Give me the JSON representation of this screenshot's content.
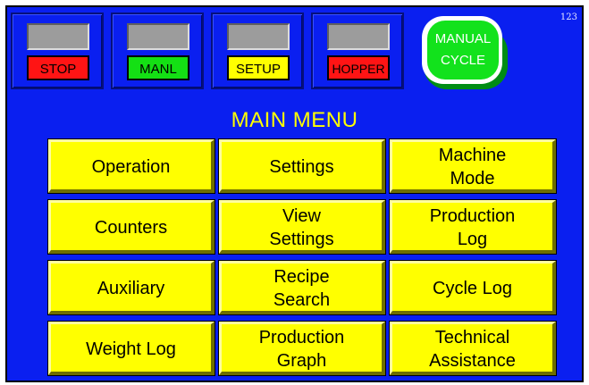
{
  "screen_number": "123",
  "status_indicators": [
    {
      "id": "stop",
      "label": "STOP",
      "color": "#ff1414"
    },
    {
      "id": "manl",
      "label": "MANL",
      "color": "#14e014"
    },
    {
      "id": "setup",
      "label": "SETUP",
      "color": "#ffff00"
    },
    {
      "id": "hopper",
      "label": "HOPPER",
      "color": "#ff1414"
    }
  ],
  "cycle_button": {
    "line1": "MANUAL",
    "line2": "CYCLE",
    "color": "#12e21c"
  },
  "title": "MAIN MENU",
  "menu_buttons": [
    {
      "id": "operation",
      "label": "Operation"
    },
    {
      "id": "settings",
      "label": "Settings"
    },
    {
      "id": "machine-mode",
      "label": "Machine\nMode"
    },
    {
      "id": "counters",
      "label": "Counters"
    },
    {
      "id": "view-settings",
      "label": "View\nSettings"
    },
    {
      "id": "production-log",
      "label": "Production\nLog"
    },
    {
      "id": "auxiliary",
      "label": "Auxiliary"
    },
    {
      "id": "recipe-search",
      "label": "Recipe\nSearch"
    },
    {
      "id": "cycle-log",
      "label": "Cycle Log"
    },
    {
      "id": "weight-log",
      "label": "Weight Log"
    },
    {
      "id": "production-graph",
      "label": "Production\nGraph"
    },
    {
      "id": "technical-assistance",
      "label": "Technical\nAssistance"
    }
  ],
  "colors": {
    "background": "#0a1ff0",
    "title": "#ffff00",
    "button_face": "#ffff00",
    "lamp_off": "#9c9c9c"
  }
}
